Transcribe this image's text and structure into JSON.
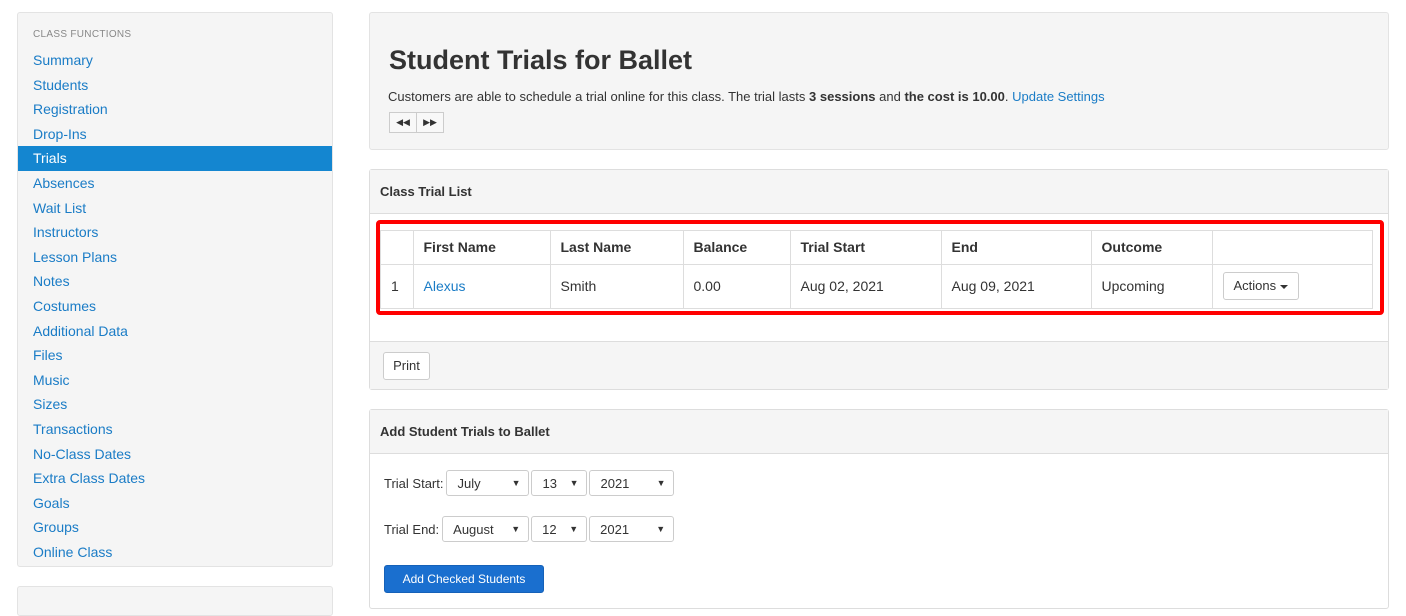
{
  "sidebar": {
    "title": "CLASS FUNCTIONS",
    "items": [
      {
        "label": "Summary"
      },
      {
        "label": "Students"
      },
      {
        "label": "Registration"
      },
      {
        "label": "Drop-Ins"
      },
      {
        "label": "Trials",
        "active": true
      },
      {
        "label": "Absences"
      },
      {
        "label": "Wait List"
      },
      {
        "label": "Instructors"
      },
      {
        "label": "Lesson Plans"
      },
      {
        "label": "Notes"
      },
      {
        "label": "Costumes"
      },
      {
        "label": "Additional Data"
      },
      {
        "label": "Files"
      },
      {
        "label": "Music"
      },
      {
        "label": "Sizes"
      },
      {
        "label": "Transactions"
      },
      {
        "label": "No-Class Dates"
      },
      {
        "label": "Extra Class Dates"
      },
      {
        "label": "Goals"
      },
      {
        "label": "Groups"
      },
      {
        "label": "Online Class"
      }
    ]
  },
  "header": {
    "title": "Student Trials for Ballet",
    "desc_pre": "Customers are able to schedule a trial online for this class. The trial lasts ",
    "desc_sessions": "3 sessions",
    "desc_mid": " and ",
    "desc_cost": "the cost is 10.00",
    "desc_dot": ". ",
    "update_link": "Update Settings",
    "prev_icon": "◀◀",
    "next_icon": "▶▶"
  },
  "trial_list": {
    "heading": "Class Trial List",
    "columns": [
      "",
      "First Name",
      "Last Name",
      "Balance",
      "Trial Start",
      "End",
      "Outcome",
      ""
    ],
    "rows": [
      {
        "num": "1",
        "first": "Alexus",
        "last": "Smith",
        "balance": "0.00",
        "start": "Aug 02, 2021",
        "end": "Aug 09, 2021",
        "outcome": "Upcoming",
        "action": "Actions"
      }
    ],
    "print_label": "Print"
  },
  "add_panel": {
    "heading": "Add Student Trials to Ballet",
    "start_label": "Trial Start:",
    "start_month": "July",
    "start_day": "13",
    "start_year": "2021",
    "end_label": "Trial End:",
    "end_month": "August",
    "end_day": "12",
    "end_year": "2021",
    "button_label": "Add Checked Students"
  },
  "colors": {
    "accent": "#1486d0",
    "link": "#1a7cc6",
    "highlight": "#ff0000",
    "primary_button": "#1a6fcf"
  }
}
